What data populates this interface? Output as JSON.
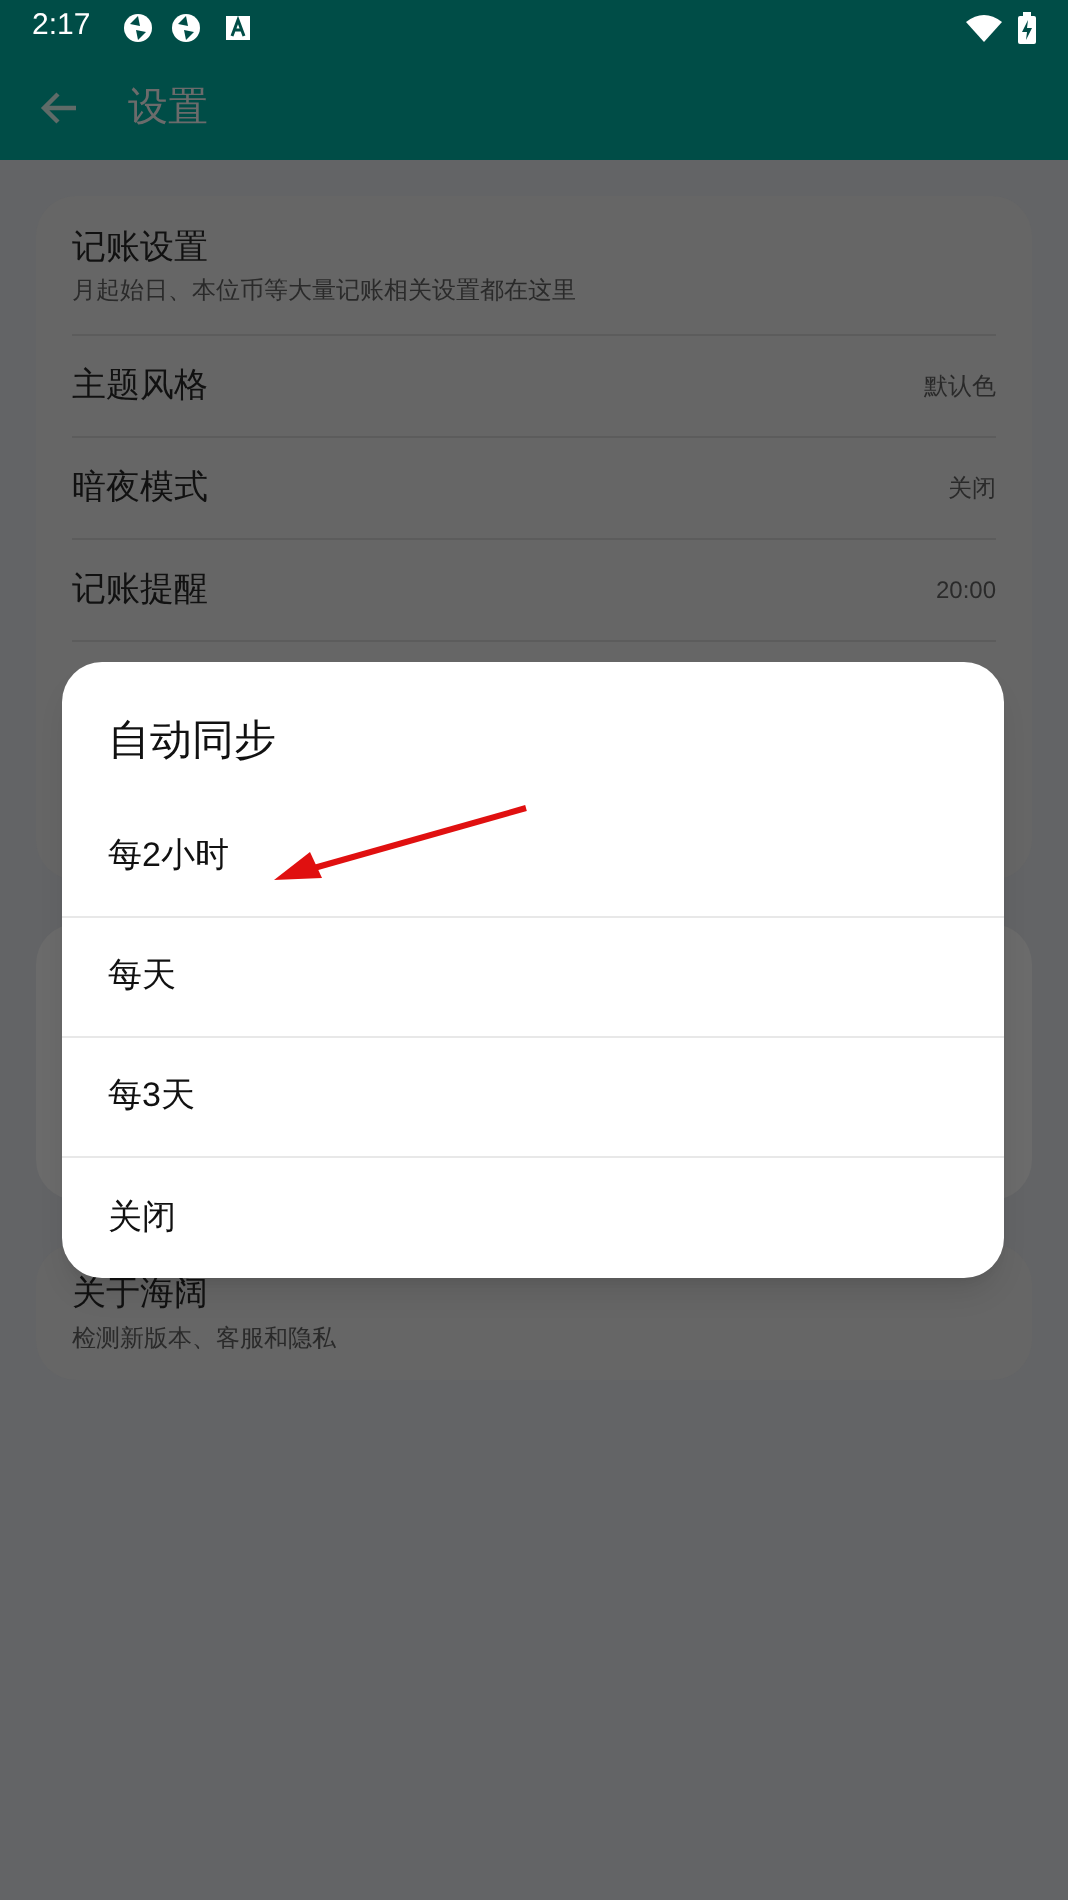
{
  "status_bar": {
    "time": "2:17"
  },
  "toolbar": {
    "title": "设置"
  },
  "settings": [
    {
      "title": "记账设置",
      "subtitle": "月起始日、本位币等大量记账相关设置都在这里"
    },
    {
      "title": "主题风格",
      "value": "默认色"
    },
    {
      "title": "暗夜模式",
      "value": "关闭"
    },
    {
      "title": "记账提醒",
      "value": "20:00"
    }
  ],
  "about": {
    "title": "关于海阔",
    "subtitle": "检测新版本、客服和隐私"
  },
  "dialog": {
    "title": "自动同步",
    "options": [
      "每2小时",
      "每天",
      "每3天",
      "关闭"
    ]
  }
}
